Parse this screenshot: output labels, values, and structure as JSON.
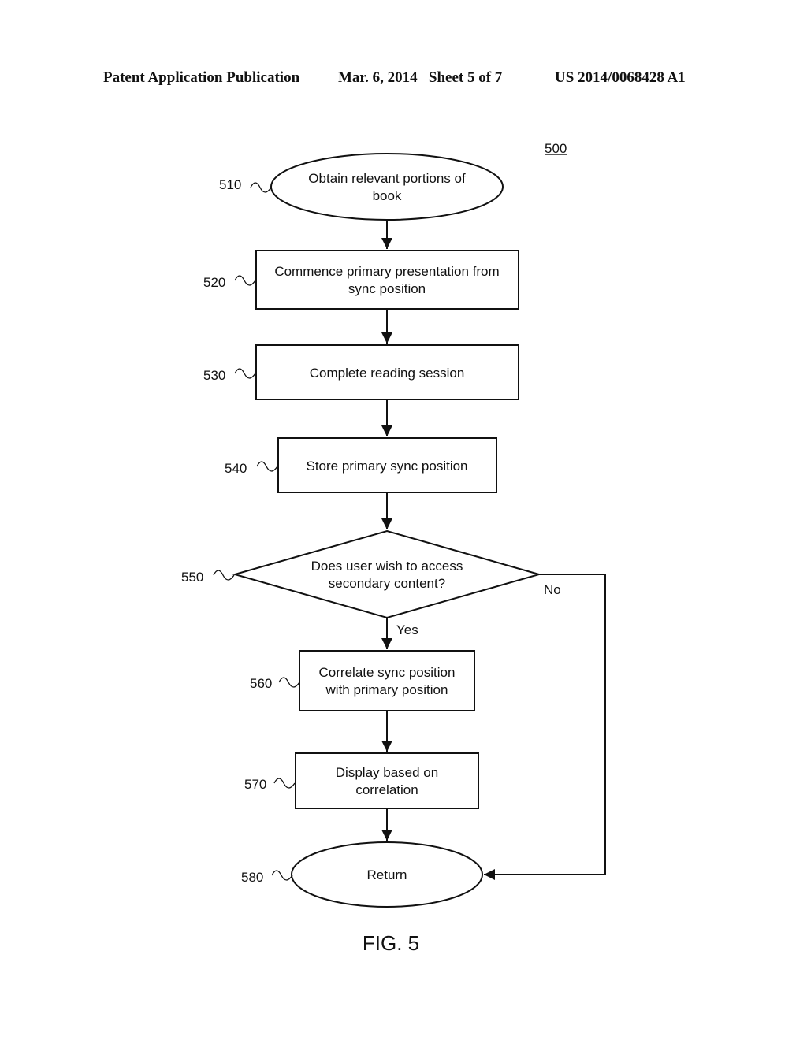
{
  "header": {
    "publication_type": "Patent Application Publication",
    "date_sheet": "Mar. 6, 2014   Sheet 5 of 7",
    "publication_number": "US 2014/0068428 A1"
  },
  "figure": {
    "diagram_ref": "500",
    "caption": "FIG. 5",
    "nodes": [
      {
        "id": "510",
        "shape": "ellipse",
        "lines": [
          "Obtain relevant portions of",
          "book"
        ]
      },
      {
        "id": "520",
        "shape": "rect",
        "lines": [
          "Commence primary presentation from",
          "sync position"
        ]
      },
      {
        "id": "530",
        "shape": "rect",
        "lines": [
          "Complete reading session"
        ]
      },
      {
        "id": "540",
        "shape": "rect",
        "lines": [
          "Store primary sync position"
        ]
      },
      {
        "id": "550",
        "shape": "diamond",
        "lines": [
          "Does user wish to access",
          "secondary content?"
        ]
      },
      {
        "id": "560",
        "shape": "rect",
        "lines": [
          "Correlate sync position",
          "with primary position"
        ]
      },
      {
        "id": "570",
        "shape": "rect",
        "lines": [
          "Display based on",
          "correlation"
        ]
      },
      {
        "id": "580",
        "shape": "ellipse",
        "lines": [
          "Return"
        ]
      }
    ],
    "edges": [
      {
        "from": "510",
        "to": "520",
        "label": ""
      },
      {
        "from": "520",
        "to": "530",
        "label": ""
      },
      {
        "from": "530",
        "to": "540",
        "label": ""
      },
      {
        "from": "540",
        "to": "550",
        "label": ""
      },
      {
        "from": "550",
        "to": "560",
        "label": "Yes"
      },
      {
        "from": "560",
        "to": "570",
        "label": ""
      },
      {
        "from": "570",
        "to": "580",
        "label": ""
      },
      {
        "from": "550",
        "to": "580",
        "label": "No"
      }
    ]
  }
}
